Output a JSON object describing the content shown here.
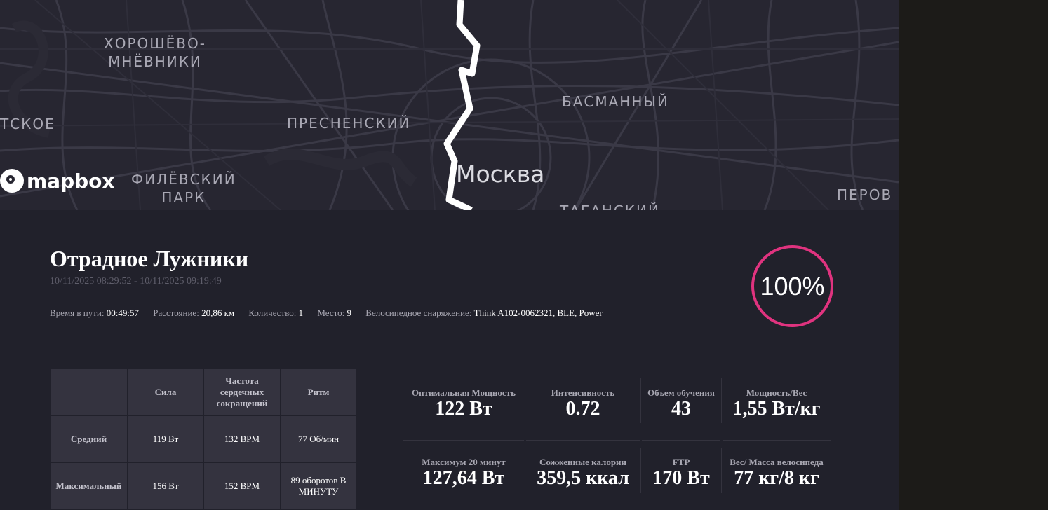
{
  "map": {
    "districts": [
      "ХОРОШЁВО-\nМНЁВНИКИ",
      "БАСМАННЫЙ",
      "ТСКОЕ",
      "ПРЕСНЕНСКИЙ",
      "ФИЛЁВСКИЙ\nПАРК",
      "ПЕРОВ",
      "ТАГАНСКИЙ"
    ],
    "city": "Москва",
    "logo": "mapbox"
  },
  "workout": {
    "title": "Отрадное Лужники",
    "date_range": "10/11/2025 08:29:52 - 10/11/2025 09:19:49",
    "meta": [
      {
        "label": "Время в пути:",
        "value": "00:49:57"
      },
      {
        "label": "Расстояние:",
        "value": "20,86 км"
      },
      {
        "label": "Количество:",
        "value": "1"
      },
      {
        "label": "Место:",
        "value": "9"
      },
      {
        "label": "Велосипедное снаряжение:",
        "value": "Think A102-0062321, BLE, Power"
      }
    ],
    "completion": "100%"
  },
  "colors": {
    "accent_ring": "#e0337f",
    "panel_bg": "#21212b",
    "map_bg": "#272631"
  },
  "table": {
    "headers": [
      "",
      "Сила",
      "Частота сердечных сокращений",
      "Ритм"
    ],
    "rows": [
      [
        "Средний",
        "119 Вт",
        "132 BPM",
        "77 Об/мин"
      ],
      [
        "Максимальный",
        "156 Вт",
        "152 BPM",
        "89 оборотов В МИНУТУ"
      ]
    ]
  },
  "metrics": [
    {
      "label": "Оптимальная Мощность",
      "value": "122 Вт"
    },
    {
      "label": "Интенсивность",
      "value": "0.72"
    },
    {
      "label": "Объем обучения",
      "value": "43"
    },
    {
      "label": "Мощность/Вес",
      "value": "1,55 Вт/кг"
    },
    {
      "label": "Максимум 20 минут",
      "value": "127,64 Вт"
    },
    {
      "label": "Сожженные калории",
      "value": "359,5 ккал"
    },
    {
      "label": "FTP",
      "value": "170 Вт"
    },
    {
      "label": "Вес/ Масса велосипеда",
      "value": "77 кг/8 кг"
    }
  ]
}
